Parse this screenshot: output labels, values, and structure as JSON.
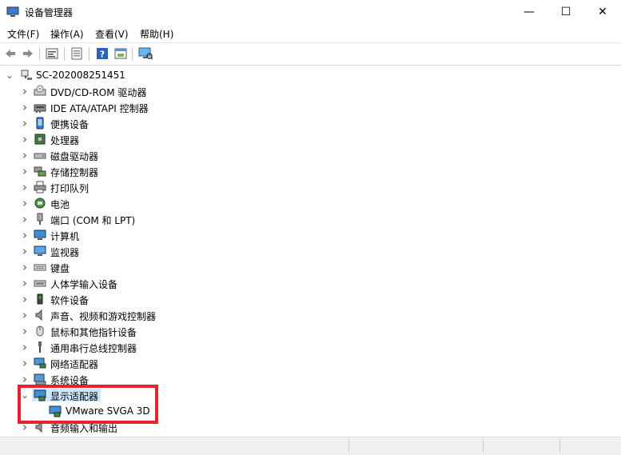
{
  "window": {
    "title": "设备管理器",
    "minimize_glyph": "—",
    "maximize_glyph": "☐",
    "close_glyph": "✕"
  },
  "menu": [
    {
      "label": "文件(F)"
    },
    {
      "label": "操作(A)"
    },
    {
      "label": "查看(V)"
    },
    {
      "label": "帮助(H)"
    }
  ],
  "toolbar": {
    "buttons": [
      "back-arrow-icon",
      "forward-arrow-icon",
      "properties-icon",
      "update-driver-icon",
      "help-icon",
      "view-icon",
      "monitor-scan-icon"
    ]
  },
  "tree": {
    "root": "SC-202008251451",
    "categories": [
      {
        "label": "DVD/CD-ROM 驱动器",
        "icon": "dvd-drive-icon"
      },
      {
        "label": "IDE ATA/ATAPI 控制器",
        "icon": "ide-controller-icon"
      },
      {
        "label": "便携设备",
        "icon": "portable-device-icon"
      },
      {
        "label": "处理器",
        "icon": "processor-icon"
      },
      {
        "label": "磁盘驱动器",
        "icon": "disk-drive-icon"
      },
      {
        "label": "存储控制器",
        "icon": "storage-controller-icon"
      },
      {
        "label": "打印队列",
        "icon": "printer-icon"
      },
      {
        "label": "电池",
        "icon": "battery-icon"
      },
      {
        "label": "端口 (COM 和 LPT)",
        "icon": "port-icon"
      },
      {
        "label": "计算机",
        "icon": "computer-icon"
      },
      {
        "label": "监视器",
        "icon": "monitor-icon"
      },
      {
        "label": "键盘",
        "icon": "keyboard-icon"
      },
      {
        "label": "人体学输入设备",
        "icon": "hid-icon"
      },
      {
        "label": "软件设备",
        "icon": "software-device-icon"
      },
      {
        "label": "声音、视频和游戏控制器",
        "icon": "sound-icon"
      },
      {
        "label": "鼠标和其他指针设备",
        "icon": "mouse-icon"
      },
      {
        "label": "通用串行总线控制器",
        "icon": "usb-icon"
      },
      {
        "label": "网络适配器",
        "icon": "network-adapter-icon"
      },
      {
        "label": "系统设备",
        "icon": "system-device-icon"
      },
      {
        "label": "显示适配器",
        "icon": "display-adapter-icon",
        "expanded": true,
        "selected": true
      },
      {
        "label": "VMware SVGA 3D",
        "icon": "display-adapter-icon",
        "child": true
      },
      {
        "label": "音频输入和输出",
        "icon": "audio-io-icon"
      }
    ]
  },
  "colors": {
    "highlight": "#e8222a",
    "selection": "#cce8ff"
  }
}
